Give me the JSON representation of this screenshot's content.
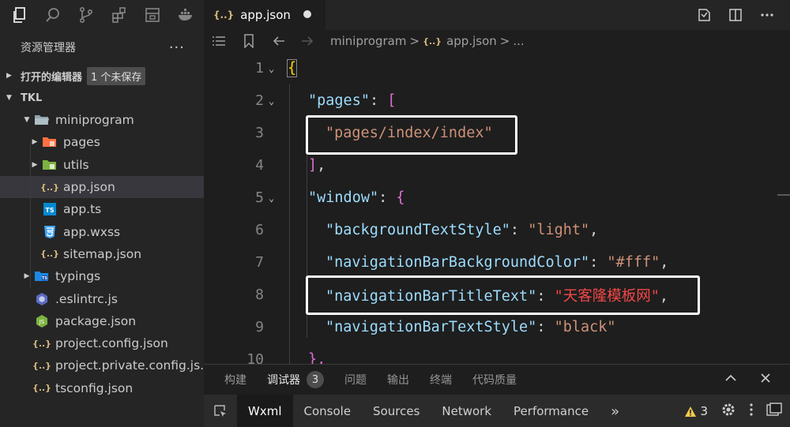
{
  "sidebar": {
    "title": "资源管理器",
    "more": "···",
    "open_editors": {
      "label": "打开的编辑器",
      "badge": "1 个未保存"
    },
    "project": {
      "label": "TKL"
    },
    "items": [
      {
        "label": "miniprogram",
        "icon": "folder-open-icon"
      },
      {
        "label": "pages",
        "icon": "folder-pages-icon"
      },
      {
        "label": "utils",
        "icon": "folder-utils-icon"
      },
      {
        "label": "app.json",
        "icon": "json-icon"
      },
      {
        "label": "app.ts",
        "icon": "typescript-icon"
      },
      {
        "label": "app.wxss",
        "icon": "css-icon"
      },
      {
        "label": "sitemap.json",
        "icon": "json-icon"
      },
      {
        "label": "typings",
        "icon": "folder-typings-icon"
      },
      {
        "label": ".eslintrc.js",
        "icon": "eslint-icon"
      },
      {
        "label": "package.json",
        "icon": "nodejs-icon"
      },
      {
        "label": "project.config.json",
        "icon": "json-icon"
      },
      {
        "label": "project.private.config.js...",
        "icon": "json-icon"
      },
      {
        "label": "tsconfig.json",
        "icon": "json-icon"
      }
    ]
  },
  "tab": {
    "icon_text": "{..}",
    "label": "app.json"
  },
  "breadcrumb": {
    "folder": "miniprogram",
    "file_icon": "{..}",
    "file": "app.json",
    "sep": ">",
    "more": "..."
  },
  "code": {
    "line_numbers": [
      "1",
      "2",
      "3",
      "4",
      "5",
      "6",
      "7",
      "8",
      "9",
      "10"
    ],
    "l1": "{",
    "l2_key": "\"pages\"",
    "l2_colon": ": ",
    "l2_br": "[",
    "l3_str": "\"pages/index/index\"",
    "l4_br": "]",
    "l4_comma": ",",
    "l5_key": "\"window\"",
    "l5_colon": ": ",
    "l5_br": "{",
    "l6_key": "\"backgroundTextStyle\"",
    "l6_colon": ": ",
    "l6_val": "\"light\"",
    "l6_comma": ",",
    "l7_key": "\"navigationBarBackgroundColor\"",
    "l7_colon": ": ",
    "l7_val": "\"#fff\"",
    "l7_comma": ",",
    "l8_key": "\"navigationBarTitleText\"",
    "l8_colon": ": ",
    "l8_val": "\"天客隆模板网\"",
    "l8_comma": ",",
    "l9_key": "\"navigationBarTextStyle\"",
    "l9_colon": ": ",
    "l9_val": "\"black\"",
    "l10": "},"
  },
  "panel": {
    "tabs": [
      "构建",
      "调试器",
      "问题",
      "输出",
      "终端",
      "代码质量"
    ],
    "debugger_count": "3",
    "devtools_tabs": [
      "Wxml",
      "Console",
      "Sources",
      "Network",
      "Performance"
    ],
    "more_tabs": "»",
    "warning_count": "3"
  },
  "colors": {
    "key": "#9cdcfe",
    "string": "#ce9178",
    "bracket_gold": "#ffd700",
    "bracket_purple": "#da70d6",
    "highlight_box": "#ffffff"
  }
}
